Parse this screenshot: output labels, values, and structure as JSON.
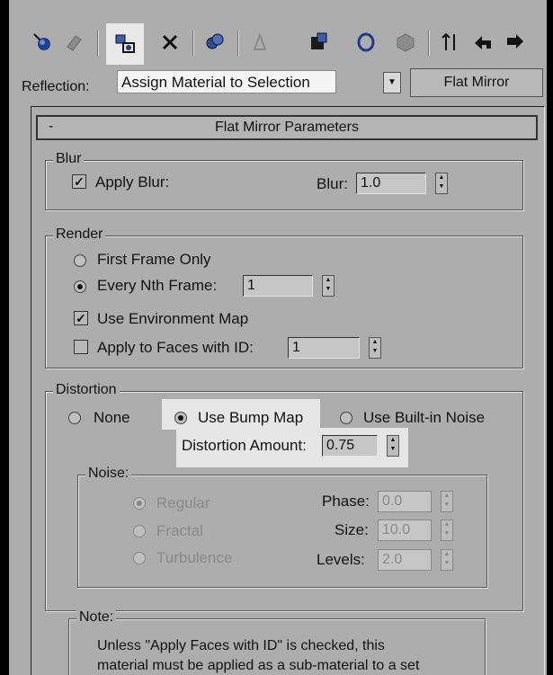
{
  "toolbar": {
    "buttons": [
      {
        "icon": "get-material-icon"
      },
      {
        "icon": "put-to-scene-icon"
      },
      {
        "icon": "assign-material-to-selection-icon",
        "active": true
      },
      {
        "icon": "reset-map-icon"
      },
      {
        "icon": "make-unique-icon"
      },
      {
        "icon": "put-to-library-icon"
      },
      {
        "icon": "material-id-channel-icon"
      },
      {
        "icon": "show-map-in-viewport-icon"
      },
      {
        "icon": "show-end-result-icon"
      },
      {
        "icon": "go-to-parent-icon"
      },
      {
        "icon": "go-forward-to-sibling-icon"
      }
    ],
    "tooltip": "Assign Material to Selection"
  },
  "type_row": {
    "label": "Reflection:",
    "type_button": "Flat Mirror"
  },
  "rollout": {
    "title": "Flat Mirror Parameters",
    "collapse_symbol": "-"
  },
  "blur": {
    "group_title": "Blur",
    "apply_blur_label": "Apply Blur:",
    "apply_blur_checked": true,
    "blur_label": "Blur:",
    "blur_value": "1.0"
  },
  "render": {
    "group_title": "Render",
    "first_frame_label": "First Frame Only",
    "every_nth_label": "Every Nth Frame:",
    "every_nth_value": "1",
    "use_env_map_label": "Use Environment Map",
    "use_env_map_checked": true,
    "apply_faces_label": "Apply to Faces with ID:",
    "apply_faces_checked": false,
    "apply_faces_value": "1"
  },
  "distortion": {
    "group_title": "Distortion",
    "none_label": "None",
    "bump_label": "Use Bump Map",
    "noise_label": "Use Built-in Noise",
    "amount_label": "Distortion Amount:",
    "amount_value": "0.75"
  },
  "noise": {
    "group_title": "Noise:",
    "regular_label": "Regular",
    "fractal_label": "Fractal",
    "turbulence_label": "Turbulence",
    "phase_label": "Phase:",
    "phase_value": "0.0",
    "size_label": "Size:",
    "size_value": "10.0",
    "levels_label": "Levels:",
    "levels_value": "2.0"
  },
  "note": {
    "group_title": "Note:",
    "line1": "Unless \"Apply Faces with ID\" is checked, this",
    "line2": "material must be applied as a sub-material to a set"
  },
  "colors": {
    "panel_bg": "#adadad",
    "highlight": "#e6e6e6",
    "window_bg": "#000000"
  }
}
